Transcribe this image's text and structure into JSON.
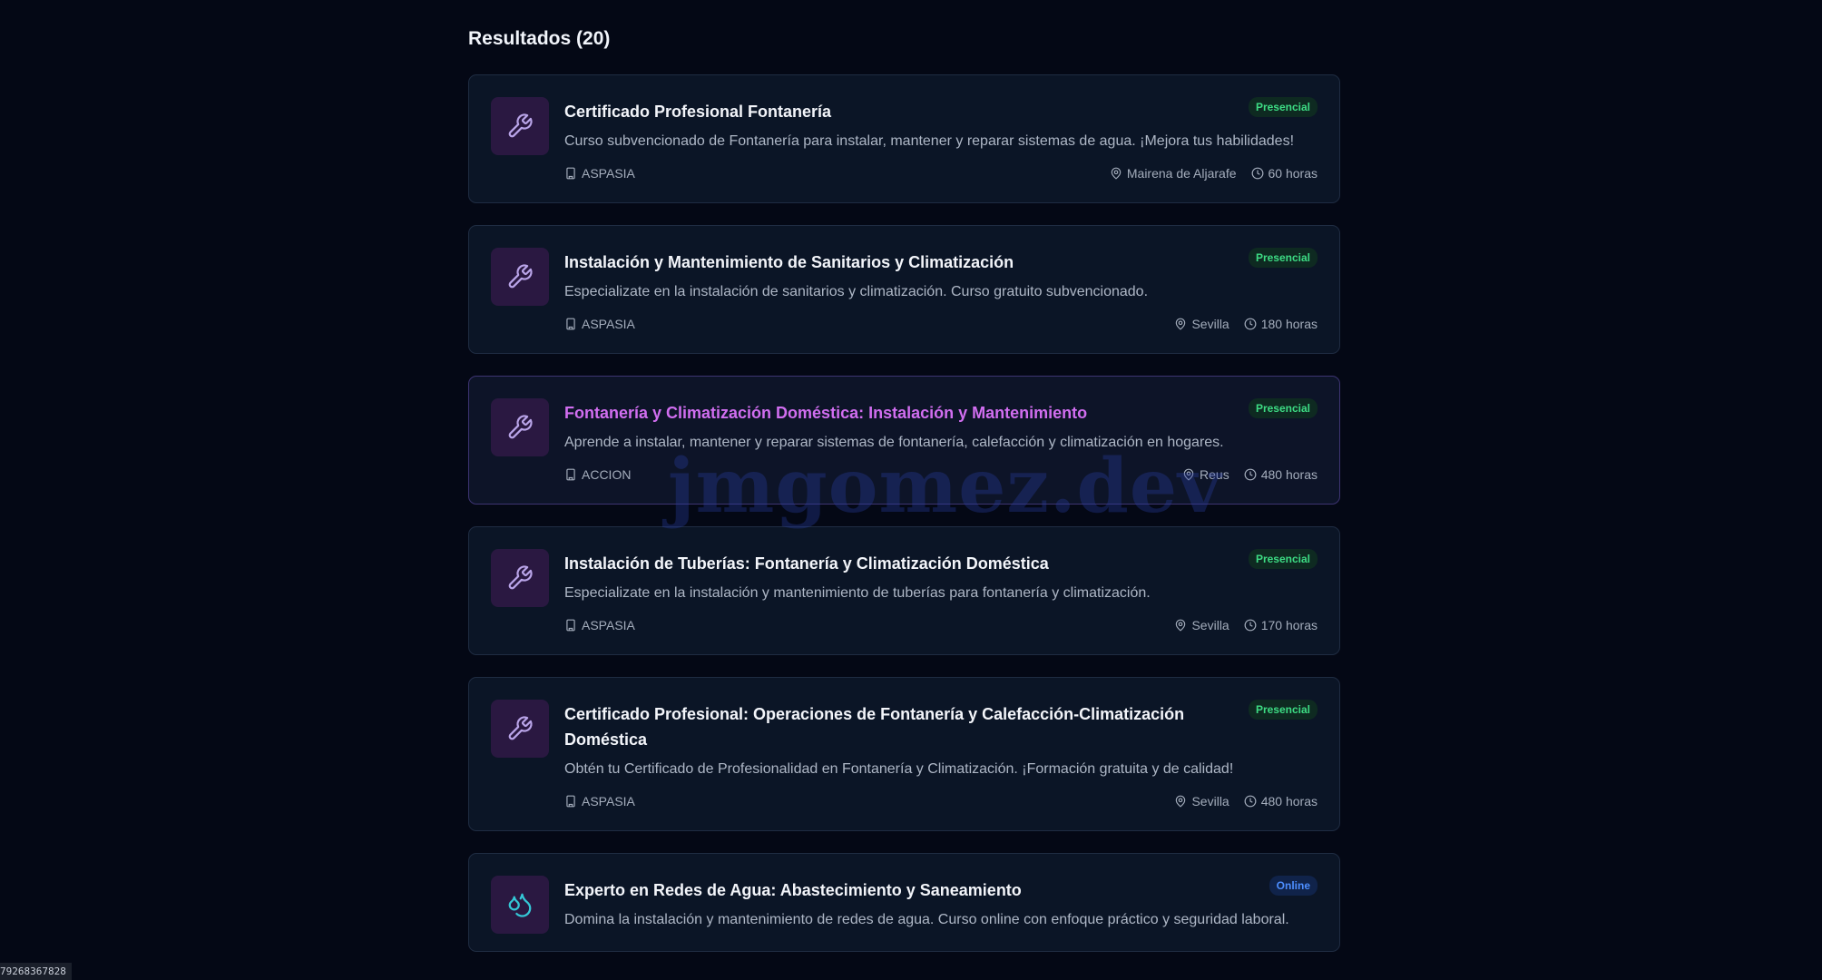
{
  "results_title": "Resultados (20)",
  "colors": {
    "background": "#040815",
    "card_bg": "#0b1526",
    "accent_purple": "#d16ef0",
    "badge_presencial": "#3ddc84",
    "badge_online": "#4d8eff",
    "icon_wrench": "#b9a4e8",
    "icon_drop": "#34c7d6"
  },
  "cards": [
    {
      "title": "Certificado Profesional Fontanería",
      "badge": "Presencial",
      "description": "Curso subvencionado de Fontanería para instalar, mantener y reparar sistemas de agua. ¡Mejora tus habilidades!",
      "provider": "ASPASIA",
      "location": "Mairena de Aljarafe",
      "hours": "60 horas",
      "icon": "wrench-icon"
    },
    {
      "title": "Instalación y Mantenimiento de Sanitarios y Climatización",
      "badge": "Presencial",
      "description": "Especializate en la instalación de sanitarios y climatización. Curso gratuito subvencionado.",
      "provider": "ASPASIA",
      "location": "Sevilla",
      "hours": "180 horas",
      "icon": "wrench-icon"
    },
    {
      "title": "Fontanería y Climatización Doméstica: Instalación y Mantenimiento",
      "badge": "Presencial",
      "description": "Aprende a instalar, mantener y reparar sistemas de fontanería, calefacción y climatización en hogares.",
      "provider": "ACCION",
      "location": "Reus",
      "hours": "480 horas",
      "icon": "wrench-icon"
    },
    {
      "title": "Instalación de Tuberías: Fontanería y Climatización Doméstica",
      "badge": "Presencial",
      "description": "Especializate en la instalación y mantenimiento de tuberías para fontanería y climatización.",
      "provider": "ASPASIA",
      "location": "Sevilla",
      "hours": "170 horas",
      "icon": "wrench-icon"
    },
    {
      "title": "Certificado Profesional: Operaciones de Fontanería y Calefacción-Climatización Doméstica",
      "badge": "Presencial",
      "description": "Obtén tu Certificado de Profesionalidad en Fontanería y Climatización. ¡Formación gratuita y de calidad!",
      "provider": "ASPASIA",
      "location": "Sevilla",
      "hours": "480 horas",
      "icon": "wrench-icon"
    },
    {
      "title": "Experto en Redes de Agua: Abastecimiento y Saneamiento",
      "badge": "Online",
      "description": "Domina la instalación y mantenimiento de redes de agua. Curso online con enfoque práctico y seguridad laboral.",
      "provider": "",
      "location": "",
      "hours": "",
      "icon": "water-drops-icon"
    }
  ],
  "watermark": "jmgomez.dev",
  "corner_id": "79268367828"
}
